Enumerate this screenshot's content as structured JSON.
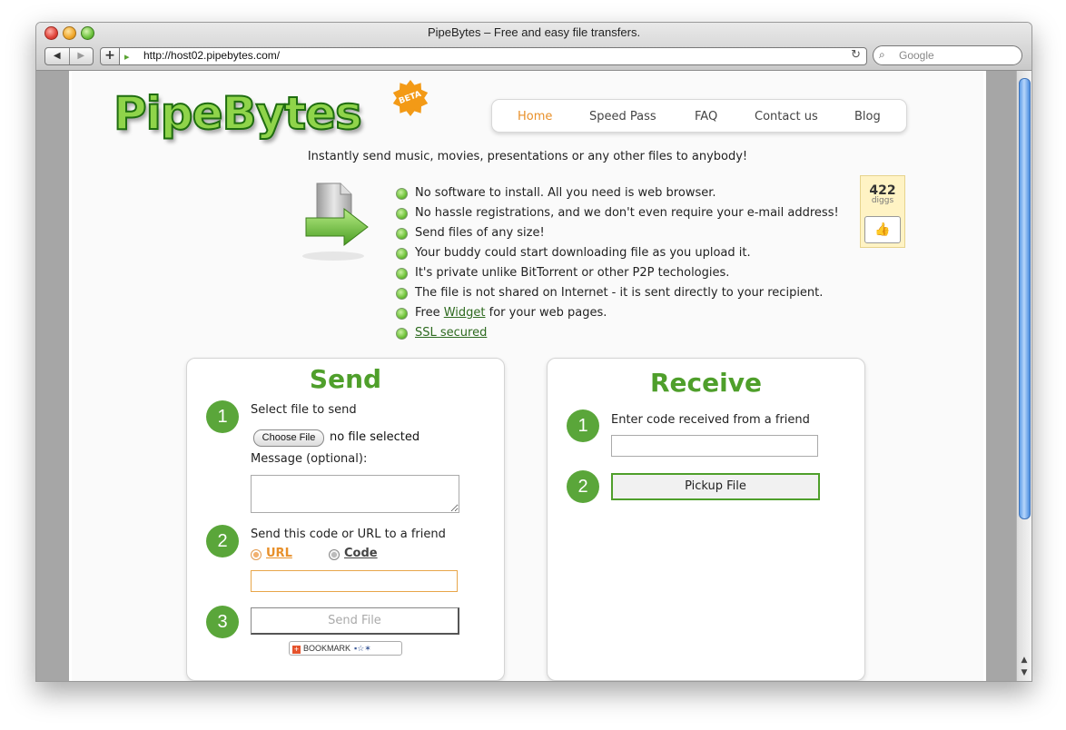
{
  "browser": {
    "window_title": "PipeBytes – Free and easy file transfers.",
    "back_icon": "◀",
    "forward_icon": "▶",
    "add_icon": "+",
    "url": "http://host02.pipebytes.com/",
    "reload_icon": "↻",
    "search_placeholder": "Google",
    "search_icon": "⌕"
  },
  "site": {
    "logo_text": "PipeBytes",
    "badge": "BETA",
    "nav": [
      {
        "label": "Home",
        "active": true
      },
      {
        "label": "Speed Pass",
        "active": false
      },
      {
        "label": "FAQ",
        "active": false
      },
      {
        "label": "Contact us",
        "active": false
      },
      {
        "label": "Blog",
        "active": false
      }
    ],
    "tagline": "Instantly send music, movies, presentations or any other files to anybody!",
    "features": [
      {
        "text": "No software to install. All you need is web browser."
      },
      {
        "text": "No hassle registrations, and we don't even require your e-mail address!"
      },
      {
        "text": "Send files of any size!"
      },
      {
        "text": "Your buddy could start downloading file as you upload it."
      },
      {
        "text": "It's private unlike BitTorrent or other P2P techologies."
      },
      {
        "text": "The file is not shared on Internet - it is sent directly to your recipient."
      },
      {
        "pre": "Free ",
        "link": "Widget",
        "post": " for your web pages."
      },
      {
        "link": "SSL secured"
      }
    ],
    "digg": {
      "count": "422",
      "label": "diggs",
      "thumb_icon": "👍"
    }
  },
  "send": {
    "title": "Send",
    "step1": "1",
    "step1_label": "Select file to send",
    "choose_button": "Choose File",
    "no_file": "no file selected",
    "message_label": "Message (optional):",
    "step2": "2",
    "step2_label": "Send this code or URL to a friend",
    "option_url": "URL",
    "option_code": "Code",
    "step3": "3",
    "send_button": "Send File",
    "bookmark_label": "BOOKMARK",
    "bookmark_plus": "+",
    "bookmark_icons": "▪☆✶"
  },
  "receive": {
    "title": "Receive",
    "step1": "1",
    "step1_label": "Enter code received from a friend",
    "step2": "2",
    "pickup_button": "Pickup File"
  },
  "colors": {
    "accent_green": "#4f9f2b",
    "nav_active": "#e8902a"
  }
}
